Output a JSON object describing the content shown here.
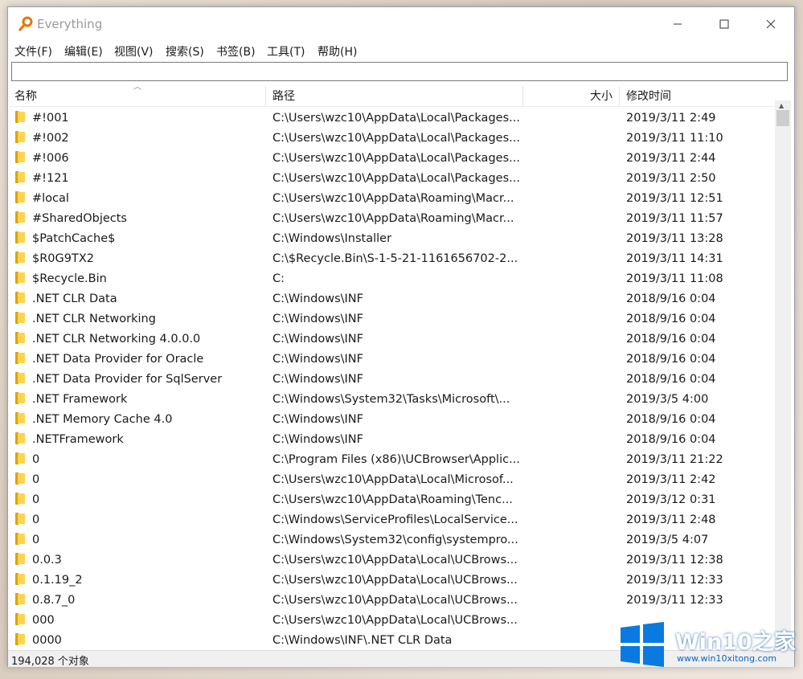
{
  "window": {
    "title": "Everything"
  },
  "menu": [
    {
      "label": "文件(F)"
    },
    {
      "label": "编辑(E)"
    },
    {
      "label": "视图(V)"
    },
    {
      "label": "搜索(S)"
    },
    {
      "label": "书签(B)"
    },
    {
      "label": "工具(T)"
    },
    {
      "label": "帮助(H)"
    }
  ],
  "search": {
    "value": ""
  },
  "columns": {
    "name": "名称",
    "path": "路径",
    "size": "大小",
    "date": "修改时间"
  },
  "rows": [
    {
      "name": "#!001",
      "path": "C:\\Users\\wzc10\\AppData\\Local\\Packages...",
      "size": "",
      "date": "2019/3/11 2:49"
    },
    {
      "name": "#!002",
      "path": "C:\\Users\\wzc10\\AppData\\Local\\Packages...",
      "size": "",
      "date": "2019/3/11 11:10"
    },
    {
      "name": "#!006",
      "path": "C:\\Users\\wzc10\\AppData\\Local\\Packages...",
      "size": "",
      "date": "2019/3/11 2:44"
    },
    {
      "name": "#!121",
      "path": "C:\\Users\\wzc10\\AppData\\Local\\Packages...",
      "size": "",
      "date": "2019/3/11 2:50"
    },
    {
      "name": "#local",
      "path": "C:\\Users\\wzc10\\AppData\\Roaming\\Macr...",
      "size": "",
      "date": "2019/3/11 12:51"
    },
    {
      "name": "#SharedObjects",
      "path": "C:\\Users\\wzc10\\AppData\\Roaming\\Macr...",
      "size": "",
      "date": "2019/3/11 11:57"
    },
    {
      "name": "$PatchCache$",
      "path": "C:\\Windows\\Installer",
      "size": "",
      "date": "2019/3/11 13:28"
    },
    {
      "name": "$R0G9TX2",
      "path": "C:\\$Recycle.Bin\\S-1-5-21-1161656702-2...",
      "size": "",
      "date": "2019/3/11 14:31"
    },
    {
      "name": "$Recycle.Bin",
      "path": "C:",
      "size": "",
      "date": "2019/3/11 11:08"
    },
    {
      "name": ".NET CLR Data",
      "path": "C:\\Windows\\INF",
      "size": "",
      "date": "2018/9/16 0:04"
    },
    {
      "name": ".NET CLR Networking",
      "path": "C:\\Windows\\INF",
      "size": "",
      "date": "2018/9/16 0:04"
    },
    {
      "name": ".NET CLR Networking 4.0.0.0",
      "path": "C:\\Windows\\INF",
      "size": "",
      "date": "2018/9/16 0:04"
    },
    {
      "name": ".NET Data Provider for Oracle",
      "path": "C:\\Windows\\INF",
      "size": "",
      "date": "2018/9/16 0:04"
    },
    {
      "name": ".NET Data Provider for SqlServer",
      "path": "C:\\Windows\\INF",
      "size": "",
      "date": "2018/9/16 0:04"
    },
    {
      "name": ".NET Framework",
      "path": "C:\\Windows\\System32\\Tasks\\Microsoft\\...",
      "size": "",
      "date": "2019/3/5 4:00"
    },
    {
      "name": ".NET Memory Cache 4.0",
      "path": "C:\\Windows\\INF",
      "size": "",
      "date": "2018/9/16 0:04"
    },
    {
      "name": ".NETFramework",
      "path": "C:\\Windows\\INF",
      "size": "",
      "date": "2018/9/16 0:04"
    },
    {
      "name": "0",
      "path": "C:\\Program Files (x86)\\UCBrowser\\Applic...",
      "size": "",
      "date": "2019/3/11 21:22"
    },
    {
      "name": "0",
      "path": "C:\\Users\\wzc10\\AppData\\Local\\Microsof...",
      "size": "",
      "date": "2019/3/11 2:42"
    },
    {
      "name": "0",
      "path": "C:\\Users\\wzc10\\AppData\\Roaming\\Tenc...",
      "size": "",
      "date": "2019/3/12 0:31"
    },
    {
      "name": "0",
      "path": "C:\\Windows\\ServiceProfiles\\LocalService...",
      "size": "",
      "date": "2019/3/11 2:48"
    },
    {
      "name": "0",
      "path": "C:\\Windows\\System32\\config\\systempro...",
      "size": "",
      "date": "2019/3/5 4:07"
    },
    {
      "name": "0.0.3",
      "path": "C:\\Users\\wzc10\\AppData\\Local\\UCBrows...",
      "size": "",
      "date": "2019/3/11 12:38"
    },
    {
      "name": "0.1.19_2",
      "path": "C:\\Users\\wzc10\\AppData\\Local\\UCBrows...",
      "size": "",
      "date": "2019/3/11 12:33"
    },
    {
      "name": "0.8.7_0",
      "path": "C:\\Users\\wzc10\\AppData\\Local\\UCBrows...",
      "size": "",
      "date": "2019/3/11 12:33"
    },
    {
      "name": "000",
      "path": "C:\\Users\\wzc10\\AppData\\Local\\UCBrows...",
      "size": "",
      "date": ""
    },
    {
      "name": "0000",
      "path": "C:\\Windows\\INF\\.NET CLR Data",
      "size": "",
      "date": ""
    }
  ],
  "status": {
    "text": "194,028 个对象"
  },
  "watermark": {
    "brand": "Win10",
    "suffix": "之家",
    "url": "www.win10xitong.com"
  },
  "colors": {
    "folder": "#ffd34d",
    "watermark_blue": "#0a64c8"
  }
}
